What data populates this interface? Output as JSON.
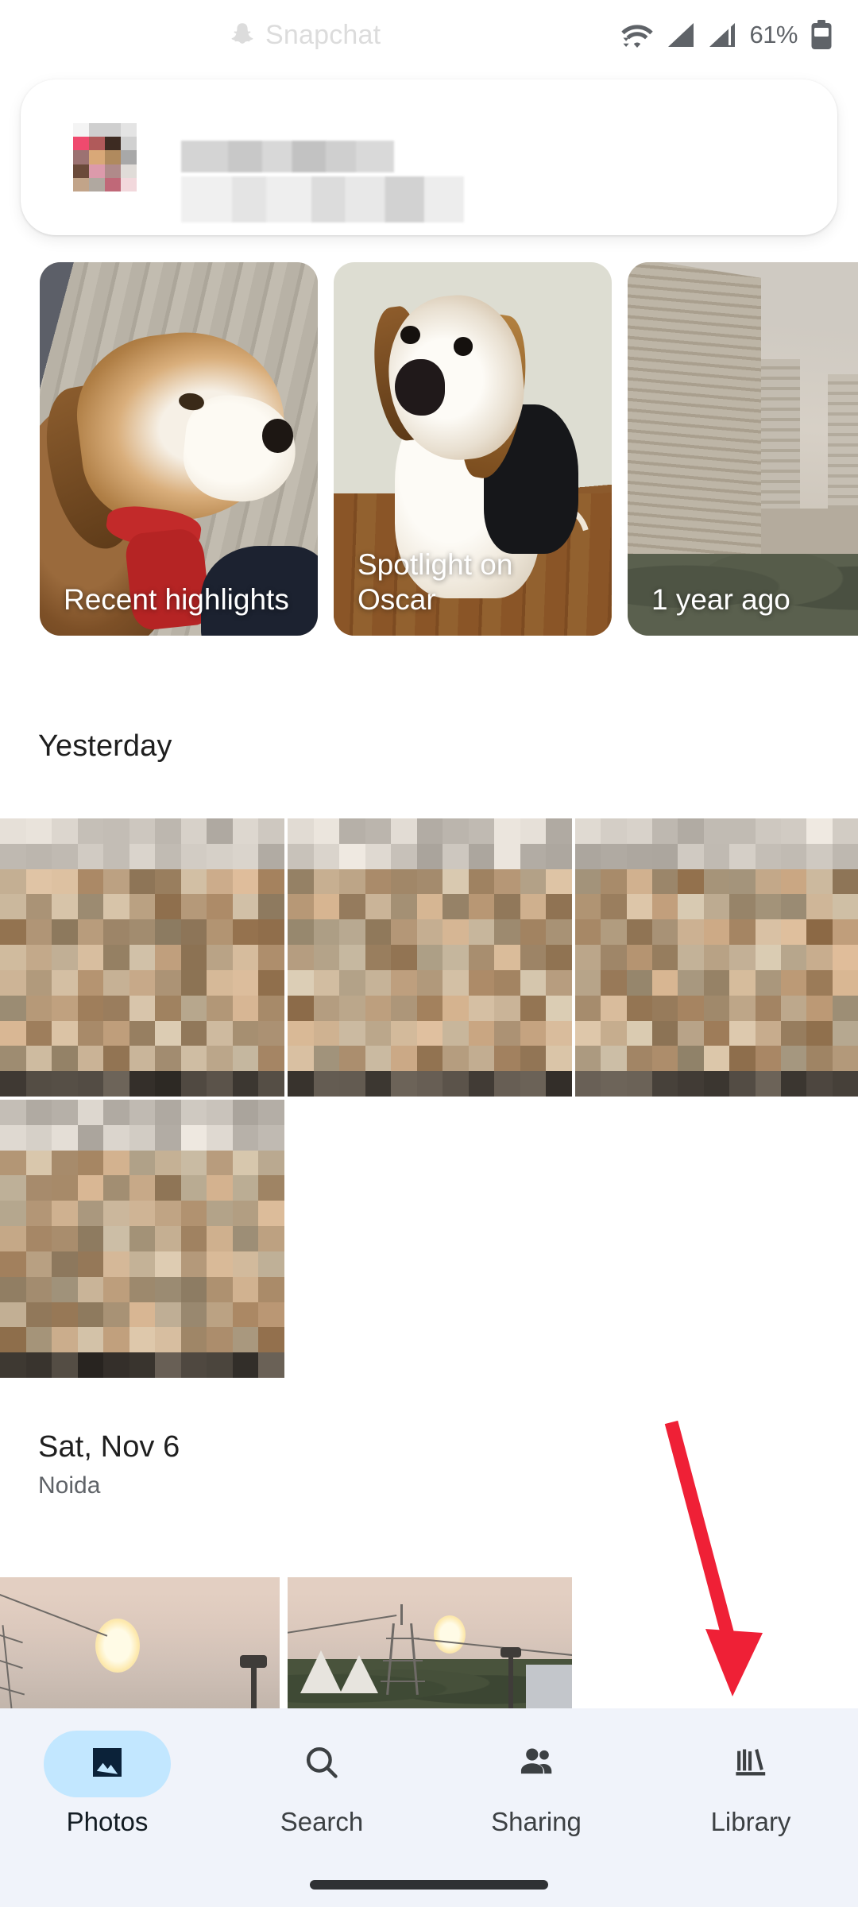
{
  "status_bar": {
    "notification_app": "Snapchat",
    "notification_icon": "snapchat-ghost-icon",
    "wifi_icon": "wifi-icon",
    "signal_icon_1": "cellular-signal-icon",
    "signal_icon_2": "cellular-signal-icon",
    "battery_percent": "61%",
    "battery_icon": "battery-icon"
  },
  "notification_card": {
    "avatar": "redacted-avatar",
    "title": "redacted-sender-name",
    "body": "redacted-message-preview"
  },
  "memories": {
    "cards": [
      {
        "label": "Recent highlights",
        "image": "beagle-on-wooden-deck"
      },
      {
        "label": "Spotlight on Oscar",
        "image": "beagle-puppy-indoors"
      },
      {
        "label": "1 year ago",
        "image": "hazy-apartment-towers"
      }
    ]
  },
  "sections": [
    {
      "title": "Yesterday",
      "subtitle": "",
      "photos": [
        "redacted-photo",
        "redacted-photo",
        "redacted-photo",
        "redacted-photo"
      ]
    },
    {
      "title": "Sat, Nov 6",
      "subtitle": "Noida",
      "photos": [
        "hazy-sun-with-power-lines",
        "hazy-sun-with-pylon-and-temples"
      ]
    }
  ],
  "annotation": {
    "arrow_color": "#ef2036",
    "arrow_target": "library-tab"
  },
  "bottom_nav": {
    "items": [
      {
        "label": "Photos",
        "icon": "photo-icon",
        "active": true
      },
      {
        "label": "Search",
        "icon": "search-icon",
        "active": false
      },
      {
        "label": "Sharing",
        "icon": "people-icon",
        "active": false
      },
      {
        "label": "Library",
        "icon": "library-icon",
        "active": false
      }
    ],
    "active_pill_color": "#c2e7ff",
    "background_color": "#f0f3fa"
  },
  "gesture_bar": "home-gesture-bar"
}
